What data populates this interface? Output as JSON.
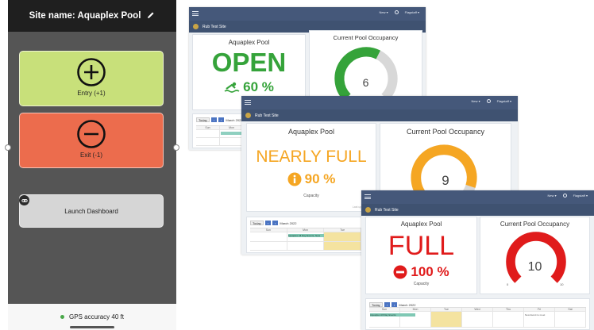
{
  "phone": {
    "site_name": "Site name: Aquaplex Pool",
    "entry_label": "Entry (+1)",
    "exit_label": "Exit (-1)",
    "launch_label": "Launch Dashboard",
    "gps_text": "GPS accuracy 40 ft",
    "colors": {
      "entry": "#c8e07a",
      "exit": "#ec6c4d",
      "gps_dot": "#4aa84a"
    }
  },
  "dashboards": [
    {
      "site_title": "Rub Test Site",
      "header_items": [
        "New ▾",
        "Flagstaff ▾"
      ],
      "pool_title": "Aquaplex Pool",
      "status": "OPEN",
      "percent": "60 %",
      "status_icon": "swimmer-icon",
      "capacity_label": "",
      "occupancy_title": "Current Pool Occupancy",
      "occupancy_value": "6",
      "fill_fraction": 0.6,
      "color": "#35a33a",
      "calendar": {
        "today_btn": "Today",
        "month": "March 2022",
        "days": [
          "Sun",
          "Mon",
          "Tue"
        ],
        "event": ""
      }
    },
    {
      "site_title": "Rub Test Site",
      "header_items": [
        "New ▾",
        "Flagstaff ▾"
      ],
      "pool_title": "Aquaplex Pool",
      "status": "NEARLY FULL",
      "percent": "90 %",
      "status_icon": "info-circle-icon",
      "capacity_label": "Capacity",
      "occupancy_title": "Current Pool Occupancy",
      "occupancy_value": "9",
      "fill_fraction": 0.9,
      "color": "#f5a623",
      "calendar": {
        "today_btn": "Today",
        "month": "March 2022",
        "days": [
          "Sun",
          "Mon",
          "Tue"
        ],
        "event": "Aquaplex All Day Events, New"
      }
    },
    {
      "site_title": "Rub Test Site",
      "header_items": [
        "New ▾",
        "Flagstaff ▾"
      ],
      "pool_title": "Aquaplex Pool",
      "status": "FULL",
      "percent": "100 %",
      "status_icon": "minus-circle-icon",
      "capacity_label": "Capacity",
      "occupancy_title": "Current Pool Occupancy",
      "occupancy_value": "10",
      "gauge_min": "0",
      "gauge_max": "10",
      "fill_fraction": 1.0,
      "color": "#e01b1b",
      "calendar": {
        "today_btn": "Today",
        "month": "March 2022",
        "days": [
          "Sun",
          "Mon",
          "Tue",
          "Wed",
          "Thu",
          "Fri",
          "Sat"
        ],
        "event": "Aquaplex All Day Events",
        "event2": "New Event to meet"
      }
    }
  ]
}
